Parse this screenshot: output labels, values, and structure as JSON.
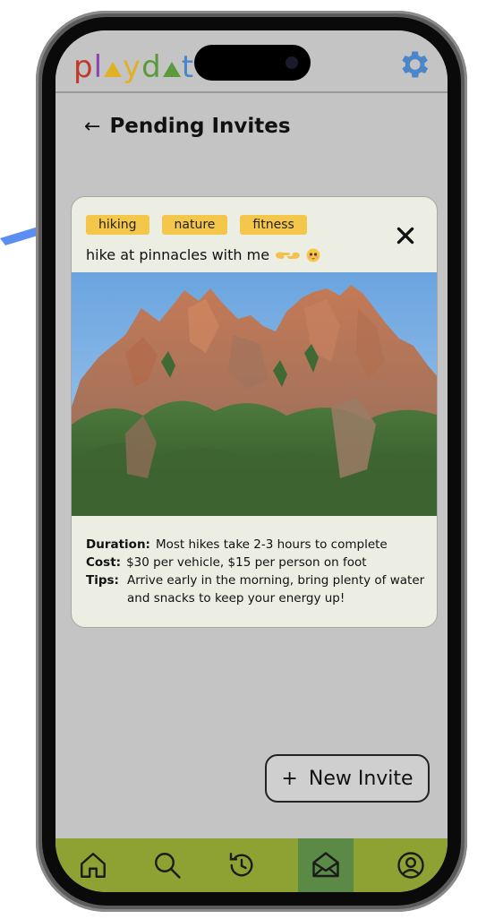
{
  "app": {
    "logo_letters": [
      "p",
      "l",
      "y",
      "d",
      "t"
    ],
    "logo_colors": [
      "#c0392b",
      "#8e44ad",
      "#e0b125",
      "#5a9a3a",
      "#4a86c8"
    ]
  },
  "header": {
    "back_symbol": "←",
    "title": "Pending Invites"
  },
  "invite": {
    "tags": [
      "hiking",
      "nature",
      "fitness"
    ],
    "title": "hike at pinnacles with me",
    "details": [
      {
        "label": "Duration:",
        "value": "Most hikes take 2-3 hours to complete"
      },
      {
        "label": "Cost:",
        "value": "$30 per vehicle, $15 per person on foot"
      },
      {
        "label": "Tips:",
        "value": "Arrive early in the morning, bring plenty of water and snacks to keep your energy up!"
      }
    ]
  },
  "actions": {
    "new_invite_symbol": "+",
    "new_invite_label": "New Invite"
  },
  "nav": {
    "items": [
      "home-icon",
      "search-icon",
      "history-icon",
      "inbox-icon",
      "profile-icon"
    ],
    "active_index": 3
  },
  "colors": {
    "screen_bg": "#c4c4c4",
    "tag_bg": "#f4c64a",
    "card_bg": "#eceee3",
    "navbar": "#8ea233",
    "navbar_active": "#5a8a46",
    "gear": "#4a86c8",
    "pointer_arrow": "#5b8ef0"
  }
}
